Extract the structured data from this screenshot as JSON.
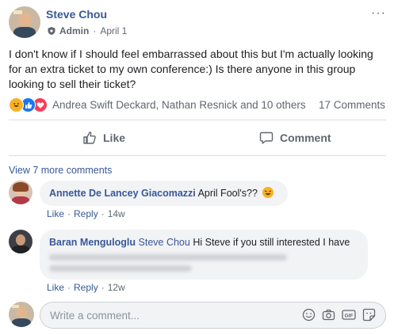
{
  "post": {
    "author": "Steve Chou",
    "role": "Admin",
    "date": "April 1",
    "more": "···",
    "text": "I don't know if I should feel embarrassed about this but I'm actually looking for an extra ticket to my own conference:) Is there anyone in this group looking to sell their ticket?",
    "reactors": "Andrea Swift Deckard, Nathan Resnick and 10 others",
    "comment_count": "17 Comments"
  },
  "actions": {
    "like": "Like",
    "comment": "Comment"
  },
  "comments_section": {
    "view_more": "View 7 more comments",
    "comments": [
      {
        "name": "Annette De Lancey Giacomazzi",
        "text": "April Fool's??",
        "like": "Like",
        "reply": "Reply",
        "time": "14w"
      },
      {
        "name": "Baran Menguloglu",
        "mention": "Steve Chou",
        "text": "Hi Steve if you still interested I have",
        "like": "Like",
        "reply": "Reply",
        "time": "12w"
      }
    ],
    "separator": "·"
  },
  "composer": {
    "placeholder": "Write a comment..."
  },
  "colors": {
    "link": "#385898",
    "secondary_text": "#606770",
    "bubble_bg": "#f2f3f5"
  }
}
